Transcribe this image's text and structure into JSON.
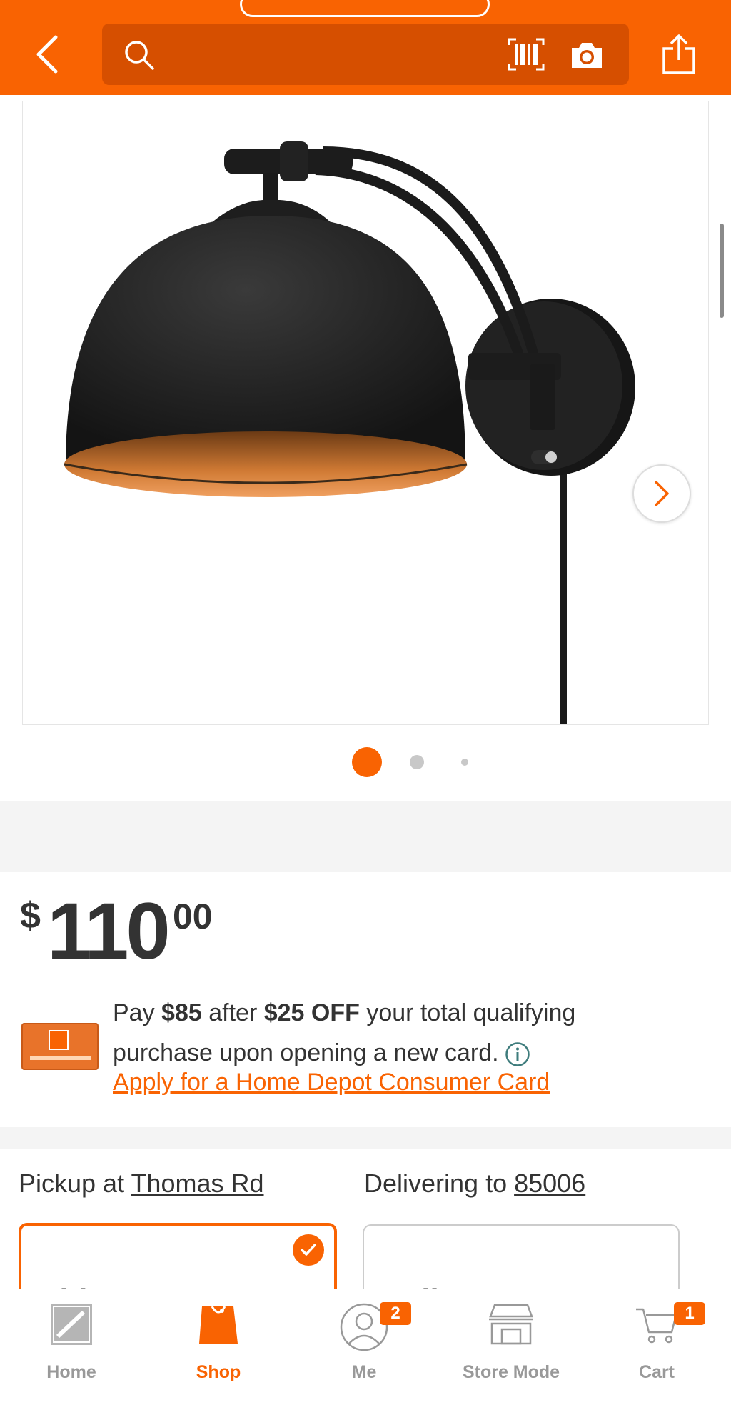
{
  "header": {
    "search_placeholder": ""
  },
  "carousel": {
    "image_count": 3,
    "active_index": 0
  },
  "price": {
    "dollar_sign": "$",
    "main": "110",
    "cents": "00"
  },
  "credit_offer": {
    "line1_pre": "Pay ",
    "line1_amount": "$85",
    "line1_mid": " after ",
    "line1_off": "$25 OFF",
    "line1_post": " your total qualifying",
    "line2": "purchase upon opening a new card.",
    "apply_link": "Apply for a Home Depot Consumer Card"
  },
  "fulfillment": {
    "pickup_prefix": "Pickup at ",
    "pickup_store": "Thomas Rd",
    "delivery_prefix": "Delivering to ",
    "delivery_zip": "85006",
    "ship_card_title": "Ship to Store",
    "delivery_card_title": "Delivery"
  },
  "tabbar": {
    "home": "Home",
    "shop": "Shop",
    "me": "Me",
    "me_badge": "2",
    "store_mode": "Store Mode",
    "cart": "Cart",
    "cart_badge": "1"
  },
  "colors": {
    "brand_orange": "#f96302",
    "header_search_bg": "#d64f00",
    "text_dark": "#333333",
    "tab_inactive": "#999999"
  }
}
